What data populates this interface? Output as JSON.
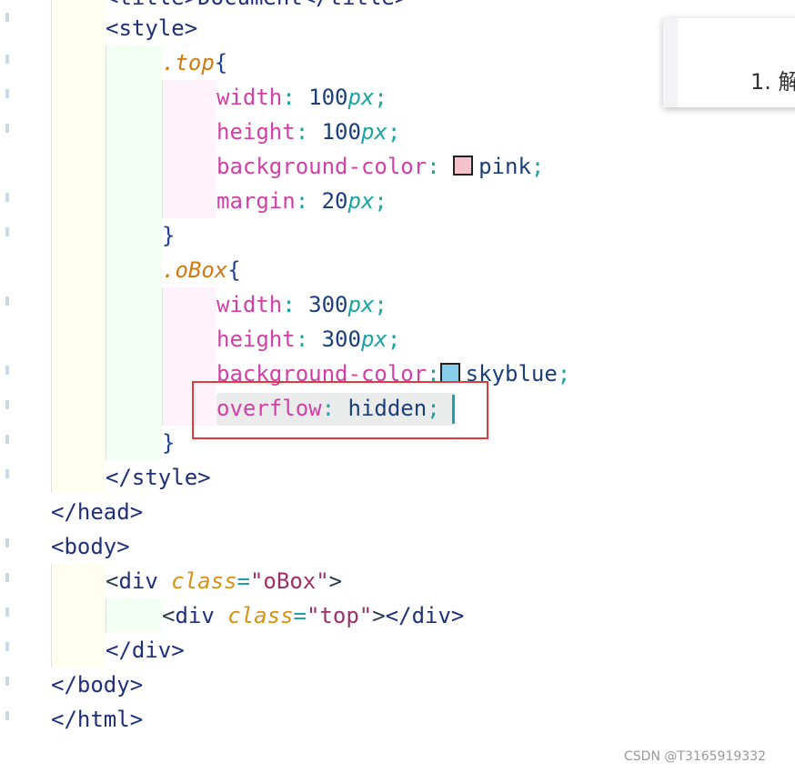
{
  "editor": {
    "line_top": "<title>Document</title>",
    "style_open": "<style>",
    "rules": [
      {
        "selector": ".top",
        "decls": [
          {
            "prop": "width",
            "num": "100",
            "unit": "px"
          },
          {
            "prop": "height",
            "num": "100",
            "unit": "px"
          },
          {
            "prop": "background-color",
            "val": "pink",
            "swatch": "#ffc0cb"
          },
          {
            "prop": "margin",
            "num": "20",
            "unit": "px"
          }
        ]
      },
      {
        "selector": ".oBox",
        "decls": [
          {
            "prop": "width",
            "num": "300",
            "unit": "px"
          },
          {
            "prop": "height",
            "num": "300",
            "unit": "px"
          },
          {
            "prop": "background-color",
            "val": "skyblue",
            "swatch": "#87ceeb"
          },
          {
            "prop": "overflow",
            "val": "hidden"
          }
        ]
      }
    ],
    "style_close": "</style>",
    "head_close": "</head>",
    "body_open": "<body>",
    "div_outer_tag": "div",
    "div_attr": "class",
    "div_outer_class": "\"oBox\"",
    "div_inner_class": "\"top\"",
    "div_close": "</div>",
    "body_close": "</body>",
    "html_close": "</html>"
  },
  "popup": {
    "text": "1. 解"
  },
  "watermark": "CSDN @T3165919332",
  "colors": {
    "highlight_box": "#e23a3a",
    "cursor": "#1aa4a4"
  }
}
